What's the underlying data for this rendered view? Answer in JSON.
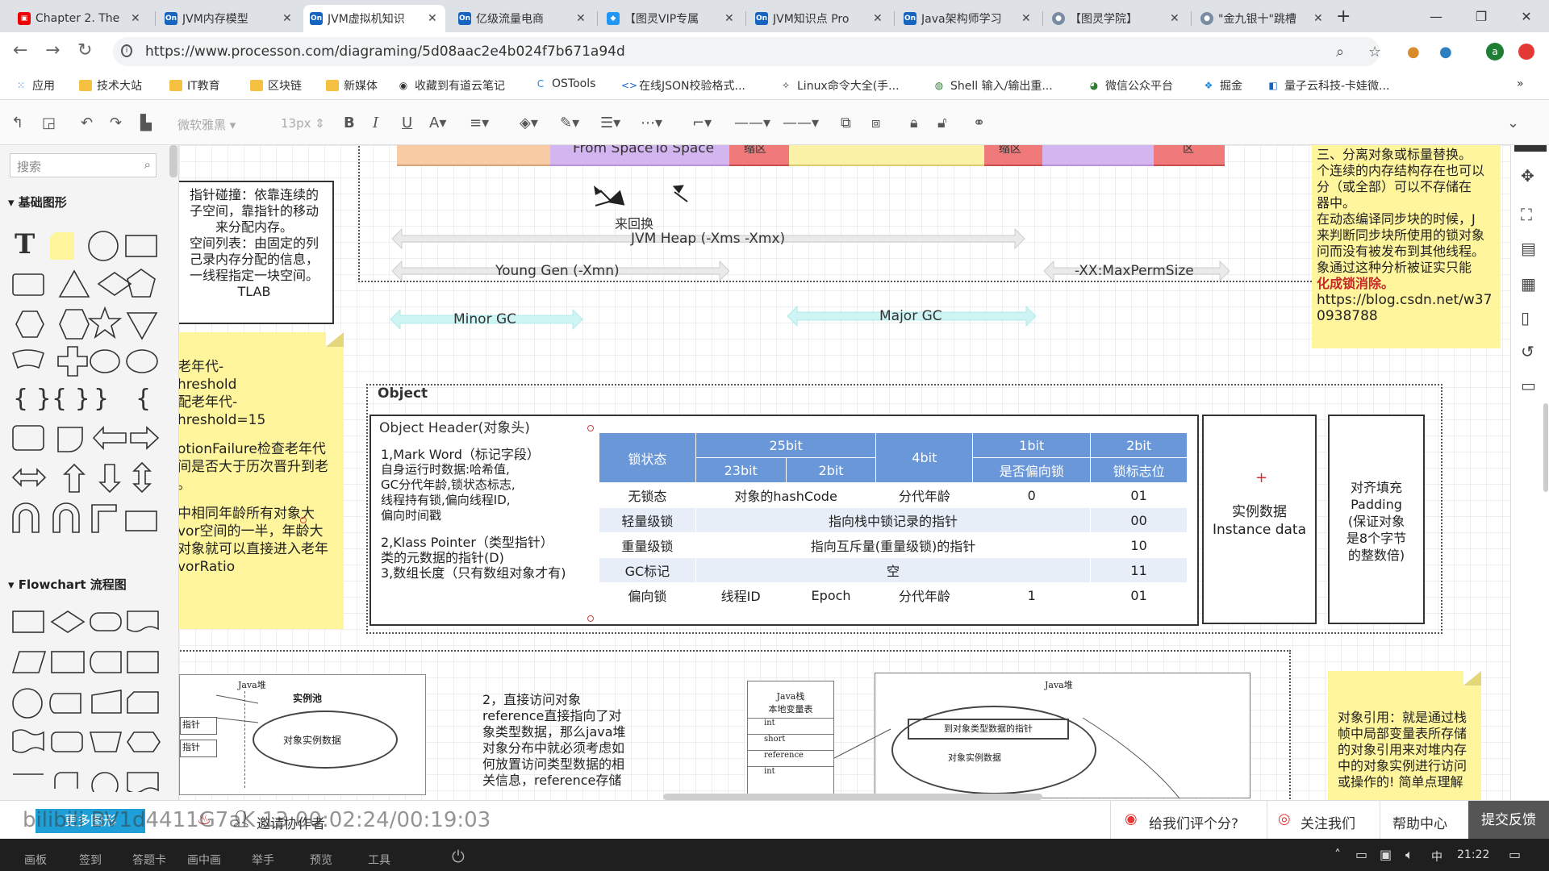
{
  "browser": {
    "tabs": [
      {
        "label": "Chapter 2. The",
        "icon": "tv-icon"
      },
      {
        "label": "JVM内存模型",
        "icon": "on-icon"
      },
      {
        "label": "JVM虚拟机知识",
        "icon": "on-icon"
      },
      {
        "label": "亿级流量电商",
        "icon": "on-icon"
      },
      {
        "label": "【图灵VIP专属",
        "icon": "shield-icon"
      },
      {
        "label": "JVM知识点 Pro",
        "icon": "on-icon"
      },
      {
        "label": "Java架构师学习",
        "icon": "on-icon"
      },
      {
        "label": "【图灵学院】",
        "icon": "user-icon"
      },
      {
        "label": "\"金九银十\"跳槽",
        "icon": "user-icon"
      }
    ],
    "url": "https://www.processon.com/diagraming/5d08aac2e4b024f7b671a94d",
    "bookmarks": [
      "应用",
      "技术大站",
      "IT教育",
      "区块链",
      "新媒体",
      "收藏到有道云笔记",
      "OSTools",
      "在线JSON校验格式...",
      "Linux命令大全(手...",
      "Shell 输入/输出重...",
      "微信公众平台",
      "掘金",
      "量子云科技-卡娃微..."
    ]
  },
  "toolbar": {
    "font": "微软雅黑",
    "size": "13px"
  },
  "left_panel": {
    "search_placeholder": "搜索",
    "section_basic": "基础图形",
    "section_flow": "Flowchart 流程图",
    "more_shapes": "更多图形"
  },
  "diagram": {
    "heap": {
      "from_space": "From Space",
      "to_space": "To Space",
      "zone1": "缩区",
      "zone2": "缩区",
      "zone3": "区",
      "swap": "来回换",
      "jvm_heap": "JVM Heap (-Xms -Xmx)",
      "young_gen": "Young Gen (-Xmn)",
      "perm": "-XX:MaxPermSize",
      "minor_gc": "Minor GC",
      "major_gc": "Major GC"
    },
    "tlab_note": [
      "指针碰撞：依靠连续的",
      "子空间，靠指针的移动",
      "来分配内存。",
      "空间列表：由固定的列",
      "己录内存分配的信息，",
      "一线程指定一块空间。",
      "TLAB"
    ],
    "old_note": [
      "老年代-",
      "hreshold",
      "配老年代-",
      "hreshold=15",
      "",
      "otionFailure检查老年代",
      "间是否大于历次晋升到老",
      "。",
      "",
      "中相同年龄所有对象大",
      "vor空间的一半，年龄大",
      "对象就可以直接进入老年",
      "vorRatio"
    ],
    "right_note": [
      "三、分离对象或标量替换。",
      "个连续的内存结构存在也可以",
      "分（或全部）可以不存储在",
      "器中。",
      "在动态编译同步块的时候，J",
      "来判断同步块所使用的锁对象",
      "问而没有被发布到其他线程。",
      "象通过这种分析被证实只能",
      "化成锁消除。",
      "https://blog.csdn.net/w37",
      "0938788"
    ],
    "object": {
      "title": "Object",
      "header_title": "Object Header(对象头)",
      "desc": [
        "1,Mark Word（标记字段）",
        "自身运行时数据:哈希值,",
        "GC分代年龄,锁状态标志,",
        "线程持有锁,偏向线程ID,",
        "偏向时间戳",
        "",
        "2,Klass Pointer（类型指针）",
        "类的元数据的指针(D)",
        "3,数组长度（只有数组对象才有)"
      ],
      "instance": [
        "实例数据",
        "Instance data"
      ],
      "padding": [
        "对齐填充",
        "Padding",
        "(保证对象",
        "是8个字节",
        "的整数倍)"
      ],
      "mark_table": {
        "h1": [
          "锁状态",
          "25bit",
          "4bit",
          "1bit",
          "2bit"
        ],
        "h2": [
          "23bit",
          "2bit",
          "是否偏向锁",
          "锁标志位"
        ],
        "rows": [
          [
            "无锁态",
            "对象的hashCode",
            "分代年龄",
            "0",
            "01"
          ],
          [
            "轻量级锁",
            "指向栈中锁记录的指针",
            "00"
          ],
          [
            "重量级锁",
            "指向互斥量(重量级锁)的指针",
            "10"
          ],
          [
            "GC标记",
            "空",
            "11"
          ],
          [
            "偏向锁",
            "线程ID",
            "Epoch",
            "分代年龄",
            "1",
            "01"
          ]
        ]
      }
    },
    "bottom": {
      "java_heap": "Java堆",
      "inst_pool": "实例池",
      "obj_inst": "对象实例数据",
      "ptr1": "指针",
      "ptr2": "指针",
      "direct_note": [
        "2，直接访问对象",
        "reference直接指向了对",
        "象类型数据，那么java堆",
        "对象分布中就必须考虑如",
        "何放置访问类型数据的相",
        "关信息，reference存储"
      ],
      "stack_title": "Java栈\n本地变量表",
      "stack_rows": [
        "int",
        "short",
        "reference",
        "int"
      ],
      "java_heap2": "Java堆",
      "to_type_ptr": "到对象类型数据的指针",
      "obj_inst2": "对象实例数据",
      "ref_note": [
        "对象引用：就是通过栈",
        "帧中局部变量表所存储",
        "的对象引用来对堆内存",
        "中的对象实例进行访问",
        "或操作的!  简单点理解"
      ]
    }
  },
  "bottombar": {
    "invite": "邀请协作者",
    "rate": "给我们评个分?",
    "follow": "关注我们",
    "help": "帮助中心",
    "feedback": "提交反馈"
  },
  "taskbar": {
    "items": [
      "画板",
      "签到",
      "答题卡",
      "画中画",
      "举手",
      "预览",
      "工具"
    ],
    "watermark": "bilibili BV1d4411G7aK 13 00:02:24/00:19:03",
    "clock": "21:22",
    "ime": "中"
  }
}
